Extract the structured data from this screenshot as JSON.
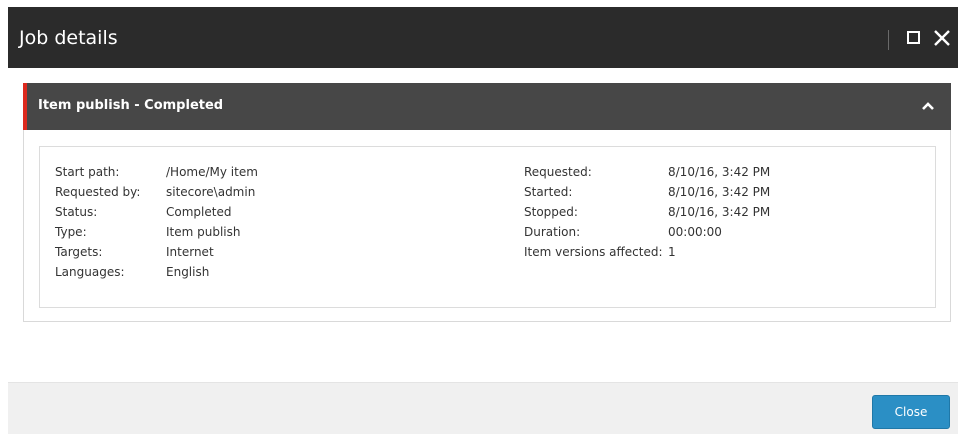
{
  "dialog": {
    "title": "Job details"
  },
  "panel": {
    "title": "Item publish - Completed"
  },
  "details_left": [
    {
      "label": "Start path:",
      "value": "/Home/My item"
    },
    {
      "label": "Requested by:",
      "value": "sitecore\\admin"
    },
    {
      "label": "Status:",
      "value": "Completed"
    },
    {
      "label": "Type:",
      "value": "Item publish"
    },
    {
      "label": "Targets:",
      "value": "Internet"
    },
    {
      "label": "Languages:",
      "value": "English"
    }
  ],
  "details_right": [
    {
      "label": "Requested:",
      "value": "8/10/16, 3:42 PM"
    },
    {
      "label": "Started:",
      "value": "8/10/16, 3:42 PM"
    },
    {
      "label": "Stopped:",
      "value": "8/10/16, 3:42 PM"
    },
    {
      "label": "Duration:",
      "value": "00:00:00"
    },
    {
      "label": "Item versions affected:",
      "value": "1"
    }
  ],
  "footer": {
    "close_label": "Close"
  },
  "colors": {
    "titlebar": "#2b2b2b",
    "panel_header": "#474747",
    "accent_red": "#dc291e",
    "button_blue": "#2b8fc5"
  }
}
